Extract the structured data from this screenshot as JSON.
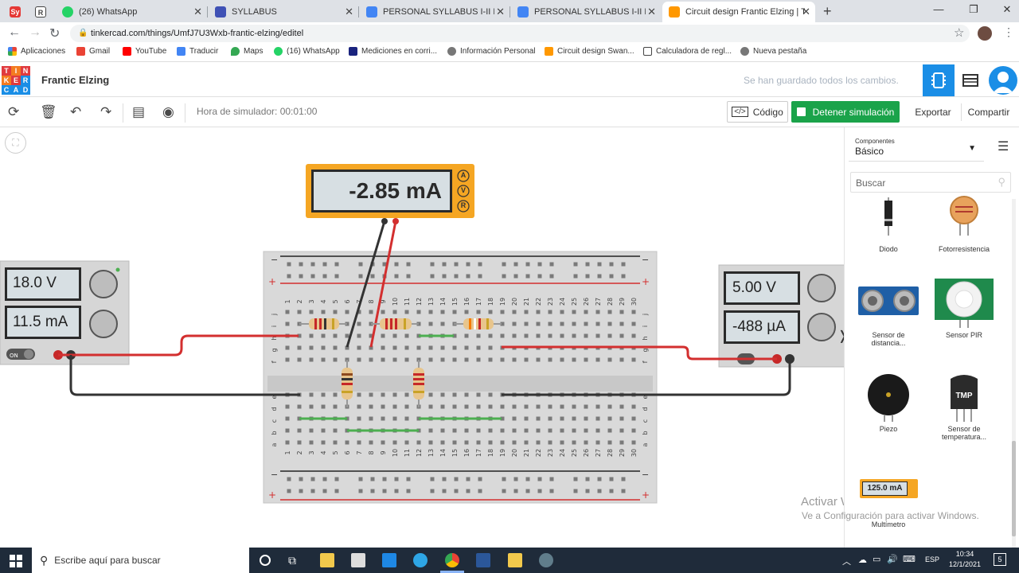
{
  "browser": {
    "tabs": [
      {
        "label": "",
        "favicon": "Sy",
        "color": "#e53935"
      },
      {
        "label": "",
        "favicon": "R",
        "color": "#444444"
      },
      {
        "label": "(26) WhatsApp",
        "favicon": "",
        "color": "#25d366"
      },
      {
        "label": "SYLLABUS",
        "favicon": "",
        "color": "#3f51b5"
      },
      {
        "label": "PERSONAL SYLLABUS I-II MSc.M",
        "favicon": "",
        "color": "#4285f4"
      },
      {
        "label": "PERSONAL SYLLABUS I-II MSc.M",
        "favicon": "",
        "color": "#4285f4"
      },
      {
        "label": "Circuit design Frantic Elzing | Tink",
        "favicon": "",
        "color": "#ff9800",
        "active": true
      }
    ],
    "url": "tinkercad.com/things/UmfJ7U3Wxb-frantic-elzing/editel",
    "bookmarks": [
      {
        "label": "Aplicaciones",
        "color": "#4285f4"
      },
      {
        "label": "Gmail",
        "color": "#ea4335"
      },
      {
        "label": "YouTube",
        "color": "#ff0000"
      },
      {
        "label": "Traducir",
        "color": "#4285f4"
      },
      {
        "label": "Maps",
        "color": "#34a853"
      },
      {
        "label": "(16) WhatsApp",
        "color": "#25d366"
      },
      {
        "label": "Mediciones en corri...",
        "color": "#1a237e"
      },
      {
        "label": "Información Personal",
        "color": "#555555"
      },
      {
        "label": "Circuit design Swan...",
        "color": "#ff9800"
      },
      {
        "label": "Calculadora de regl...",
        "color": "#444444"
      },
      {
        "label": "Nueva pestaña",
        "color": "#555555"
      }
    ]
  },
  "app": {
    "logo_letters": [
      "T",
      "I",
      "N",
      "K",
      "E",
      "R",
      "C",
      "A",
      "D"
    ],
    "project_name": "Frantic Elzing",
    "save_status": "Se han guardado todos los cambios.",
    "sim_time": "Hora de simulador: 00:01:00",
    "code_label": "Código",
    "stop_label": "Detener simulación",
    "export_label": "Exportar",
    "share_label": "Compartir"
  },
  "circuit": {
    "multimeter_reading": "-2.85 mA",
    "multimeter_modes": [
      "A",
      "V",
      "R"
    ],
    "left_supply": {
      "voltage": "18.0 V",
      "current": "11.5 mA",
      "switch": "ON"
    },
    "right_supply": {
      "voltage": "5.00 V",
      "current": "-488 µA"
    },
    "column_numbers": [
      "1",
      "2",
      "3",
      "4",
      "5",
      "6",
      "7",
      "8",
      "9",
      "10",
      "11",
      "12",
      "13",
      "14",
      "15",
      "16",
      "17",
      "18",
      "19",
      "20",
      "21",
      "22",
      "23",
      "24",
      "25",
      "26",
      "27",
      "28",
      "29",
      "30"
    ],
    "row_letters_top": [
      "j",
      "i",
      "h",
      "g",
      "f"
    ],
    "row_letters_bottom": [
      "e",
      "d",
      "c",
      "b",
      "a"
    ]
  },
  "panel": {
    "category_caption": "Componentes",
    "category_value": "Básico",
    "search_placeholder": "Buscar",
    "components": [
      {
        "label": "Diodo",
        "icon": "diode-icon"
      },
      {
        "label": "Fotorresistencia",
        "icon": "photoresistor-icon"
      },
      {
        "label": "Sensor de distancia...",
        "icon": "ultrasonic-sensor-icon"
      },
      {
        "label": "Sensor PIR",
        "icon": "pir-sensor-icon"
      },
      {
        "label": "Piezo",
        "icon": "piezo-icon"
      },
      {
        "label": "Sensor de temperatura...",
        "icon": "temperature-sensor-icon"
      },
      {
        "label": "Multímetro",
        "icon": "multimeter-icon"
      }
    ],
    "tmp_text": "TMP",
    "mini_meter_reading": "125.0 mA"
  },
  "watermark": {
    "title": "Activar Windows",
    "subtitle": "Ve a Configuración para activar Windows."
  },
  "taskbar": {
    "search_placeholder": "Escribe aquí para buscar",
    "lang": "ESP",
    "time": "10:34",
    "date": "12/1/2021",
    "notifications": "5"
  },
  "colors": {
    "stop_green": "#1aa34a",
    "accent_blue": "#1a8ee6",
    "meter_yellow": "#f5a623"
  }
}
